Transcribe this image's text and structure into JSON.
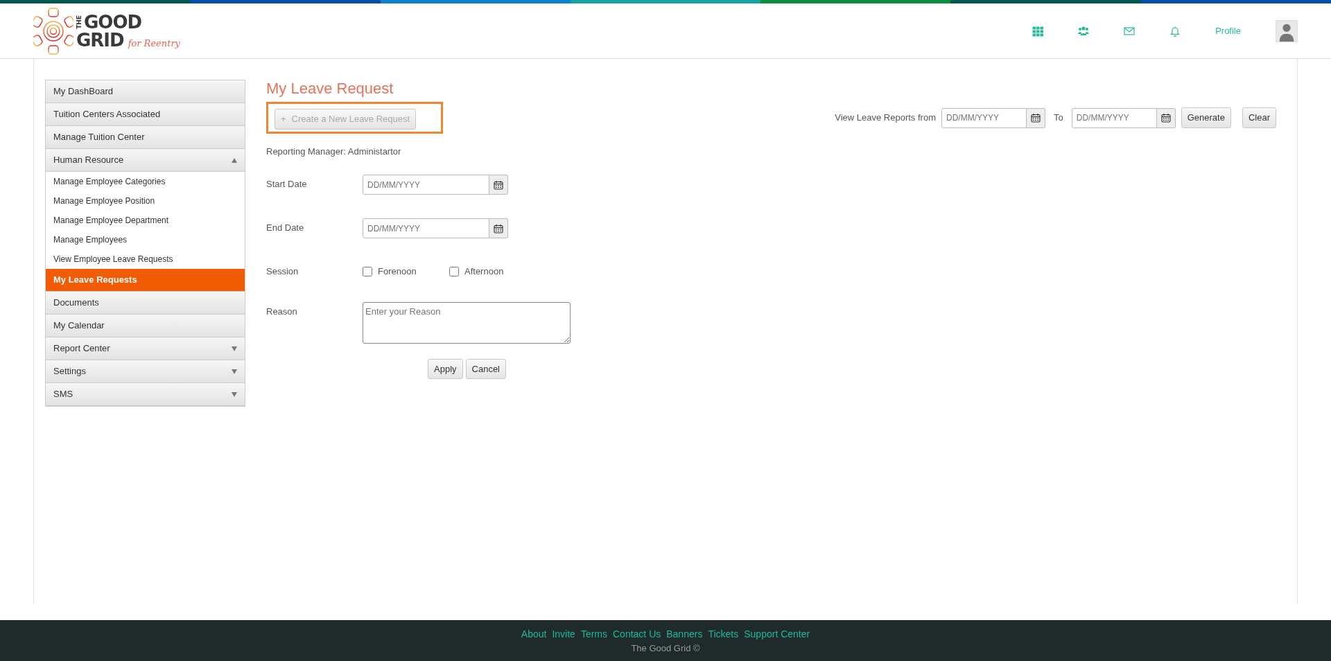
{
  "logo": {
    "word_the": "THE",
    "word_good": "GOOD",
    "word_grid": "GRID",
    "tagline": "for Reentry"
  },
  "header": {
    "icons": [
      {
        "kind": "grid"
      },
      {
        "kind": "people"
      },
      {
        "kind": "mail"
      },
      {
        "kind": "bell"
      }
    ],
    "profile_link": "Profile"
  },
  "sidebar": {
    "items": [
      {
        "label": "My DashBoard",
        "selected": false
      },
      {
        "label": "Tuition Centers Associated",
        "selected": false
      },
      {
        "label": "Manage Tuition Center",
        "selected": false
      },
      {
        "label": "Human Resource",
        "selected": false,
        "expanded": true,
        "children": [
          {
            "label": "Manage Employee Categories",
            "selected": false
          },
          {
            "label": "Manage Employee Position",
            "selected": false
          },
          {
            "label": "Manage Employee Department",
            "selected": false
          },
          {
            "label": "Manage Employees",
            "selected": false
          },
          {
            "label": "View Employee Leave Requests",
            "selected": false
          }
        ]
      },
      {
        "label": "My Leave Requests",
        "selected": true
      },
      {
        "label": "Documents",
        "selected": false
      },
      {
        "label": "My Calendar",
        "selected": false
      },
      {
        "label": "Report Center",
        "selected": false,
        "expanded": false
      },
      {
        "label": "Settings",
        "selected": false,
        "expanded": false
      },
      {
        "label": "SMS",
        "selected": false,
        "expanded": false
      }
    ]
  },
  "page": {
    "title": "My Leave Request",
    "create_button": {
      "icon": "+",
      "label": "Create a New Leave Request",
      "disabled": true,
      "highlighted": true
    },
    "report_filter": {
      "label": "View Leave Reports from",
      "from_placeholder": "DD/MM/YYYY",
      "to_label": "To",
      "to_placeholder": "DD/MM/YYYY",
      "buttons": [
        "Generate",
        "Clear"
      ]
    },
    "reporting_manager": "Reporting Manager: Administartor",
    "fields": [
      {
        "kind": "date",
        "label": "Start Date",
        "placeholder": "DD/MM/YYYY"
      },
      {
        "kind": "date",
        "label": "End Date",
        "placeholder": "DD/MM/YYYY"
      },
      {
        "kind": "checkboxes",
        "label": "Session",
        "options": [
          {
            "label": "Forenoon",
            "checked": false
          },
          {
            "label": "Afternoon",
            "checked": false
          }
        ]
      },
      {
        "kind": "textarea",
        "label": "Reason",
        "placeholder": "Enter your Reason"
      }
    ],
    "actions": [
      "Apply",
      "Cancel"
    ]
  },
  "footer": {
    "links": [
      "About",
      "Invite",
      "Terms",
      "Contact Us",
      "Banners",
      "Tickets",
      "Support Center"
    ],
    "copyright": "The Good Grid ©"
  }
}
